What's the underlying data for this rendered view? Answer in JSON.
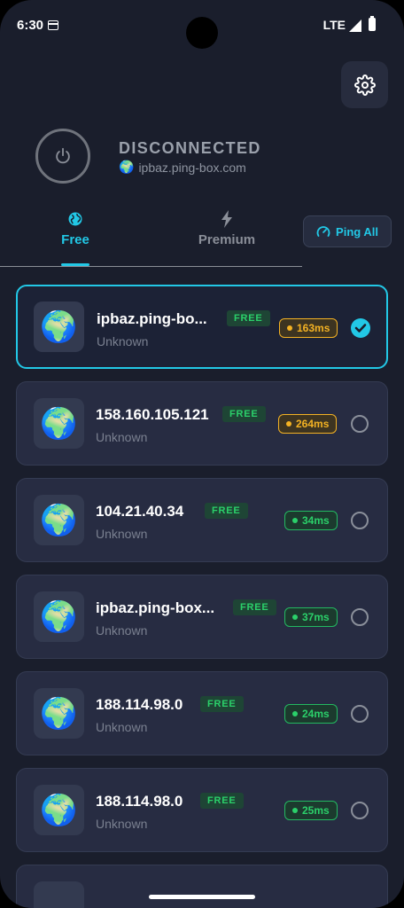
{
  "status_bar": {
    "time": "6:30",
    "network": "LTE"
  },
  "header": {
    "connection_status": "DISCONNECTED",
    "server_flag": "🌍",
    "server_host": "ipbaz.ping-box.com"
  },
  "tabs": [
    {
      "label": "Free",
      "active": true
    },
    {
      "label": "Premium",
      "active": false
    }
  ],
  "ping_all_label": "Ping All",
  "servers": [
    {
      "flag": "🌍",
      "name": "ipbaz.ping-bo...",
      "badge": "FREE",
      "location": "Unknown",
      "ping": "163ms",
      "ping_level": "slow",
      "selected": true
    },
    {
      "flag": "🌍",
      "name": "158.160.105.121",
      "badge": "FREE",
      "location": "Unknown",
      "ping": "264ms",
      "ping_level": "slow",
      "selected": false
    },
    {
      "flag": "🌍",
      "name": "104.21.40.34",
      "badge": "FREE",
      "location": "Unknown",
      "ping": "34ms",
      "ping_level": "fast",
      "selected": false
    },
    {
      "flag": "🌍",
      "name": "ipbaz.ping-box...",
      "badge": "FREE",
      "location": "Unknown",
      "ping": "37ms",
      "ping_level": "fast",
      "selected": false
    },
    {
      "flag": "🌍",
      "name": "188.114.98.0",
      "badge": "FREE",
      "location": "Unknown",
      "ping": "24ms",
      "ping_level": "fast",
      "selected": false
    },
    {
      "flag": "🌍",
      "name": "188.114.98.0",
      "badge": "FREE",
      "location": "Unknown",
      "ping": "25ms",
      "ping_level": "fast",
      "selected": false
    }
  ],
  "colors": {
    "accent": "#22c8e6",
    "free_badge": "#2bd06a",
    "ping_slow": "#f4b223",
    "ping_fast": "#2bd06a",
    "background": "#1a1e2c"
  }
}
